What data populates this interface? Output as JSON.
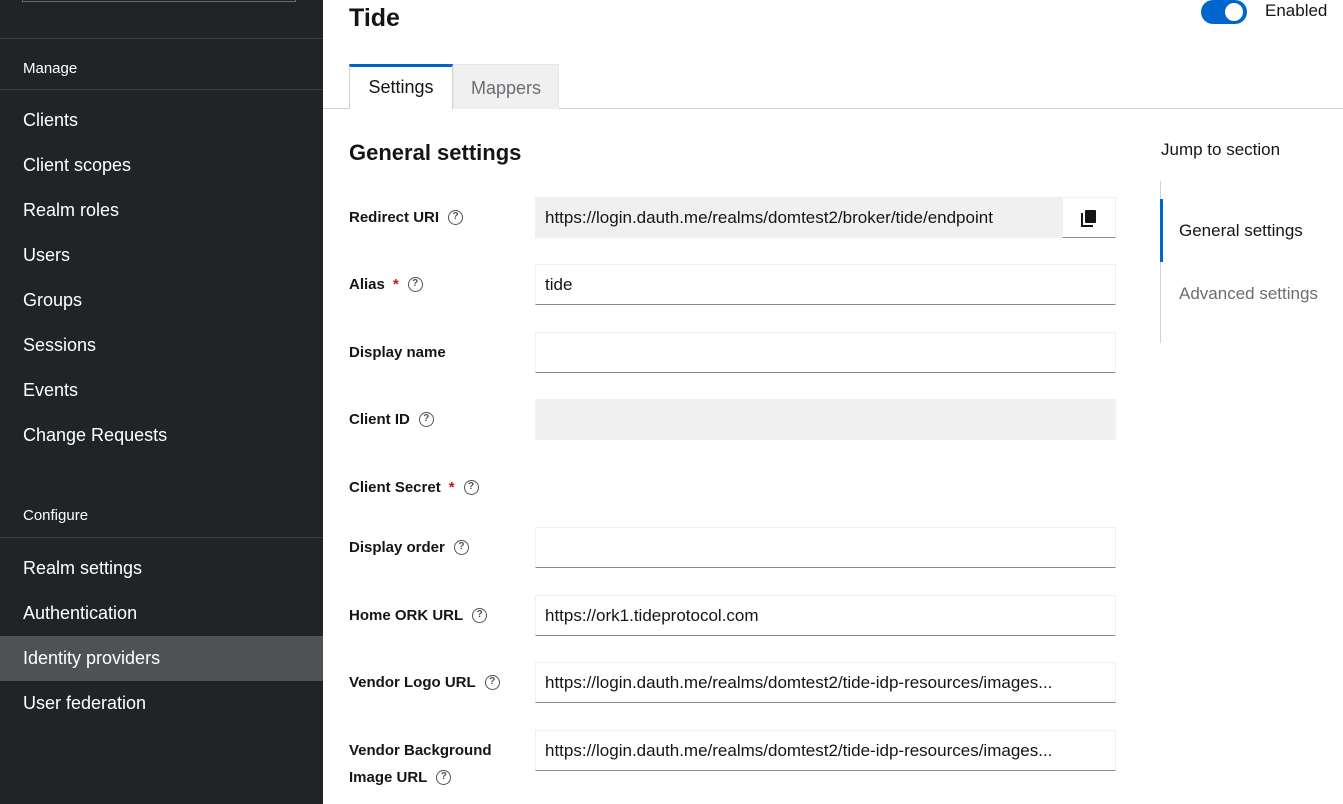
{
  "sidebar": {
    "sections": [
      {
        "title": "Manage",
        "items": [
          {
            "label": "Clients"
          },
          {
            "label": "Client scopes"
          },
          {
            "label": "Realm roles"
          },
          {
            "label": "Users"
          },
          {
            "label": "Groups"
          },
          {
            "label": "Sessions"
          },
          {
            "label": "Events"
          },
          {
            "label": "Change Requests"
          }
        ]
      },
      {
        "title": "Configure",
        "items": [
          {
            "label": "Realm settings"
          },
          {
            "label": "Authentication"
          },
          {
            "label": "Identity providers",
            "active": true
          },
          {
            "label": "User federation"
          }
        ]
      }
    ]
  },
  "header": {
    "title": "Tide",
    "enabled_label": "Enabled",
    "enabled": true
  },
  "tabs": [
    {
      "label": "Settings",
      "active": true
    },
    {
      "label": "Mappers",
      "active": false
    }
  ],
  "form": {
    "section_title": "General settings",
    "fields": {
      "redirect_uri": {
        "label": "Redirect URI",
        "value": "https://login.dauth.me/realms/domtest2/broker/tide/endpoint"
      },
      "alias": {
        "label": "Alias",
        "required_mark": "*",
        "value": "tide"
      },
      "display_name": {
        "label": "Display name",
        "value": ""
      },
      "client_id": {
        "label": "Client ID",
        "value": ""
      },
      "client_secret": {
        "label": "Client Secret",
        "required_mark": "*"
      },
      "display_order": {
        "label": "Display order",
        "value": ""
      },
      "home_ork_url": {
        "label": "Home ORK URL",
        "value": "https://ork1.tideprotocol.com"
      },
      "vendor_logo_url": {
        "label": "Vendor Logo URL",
        "value": "https://login.dauth.me/realms/domtest2/tide-idp-resources/images..."
      },
      "vendor_bg_url": {
        "label_line1": "Vendor Background",
        "label_line2": "Image URL",
        "value": "https://login.dauth.me/realms/domtest2/tide-idp-resources/images..."
      }
    },
    "help_icon": "?"
  },
  "jump": {
    "title": "Jump to section",
    "items": [
      {
        "label": "General settings",
        "active": true
      },
      {
        "label": "Advanced settings",
        "active": false
      }
    ]
  },
  "colors": {
    "sidebar_bg": "#212427",
    "active_item_bg": "#4f5255",
    "accent": "#0066cc",
    "required": "#c9190b"
  }
}
